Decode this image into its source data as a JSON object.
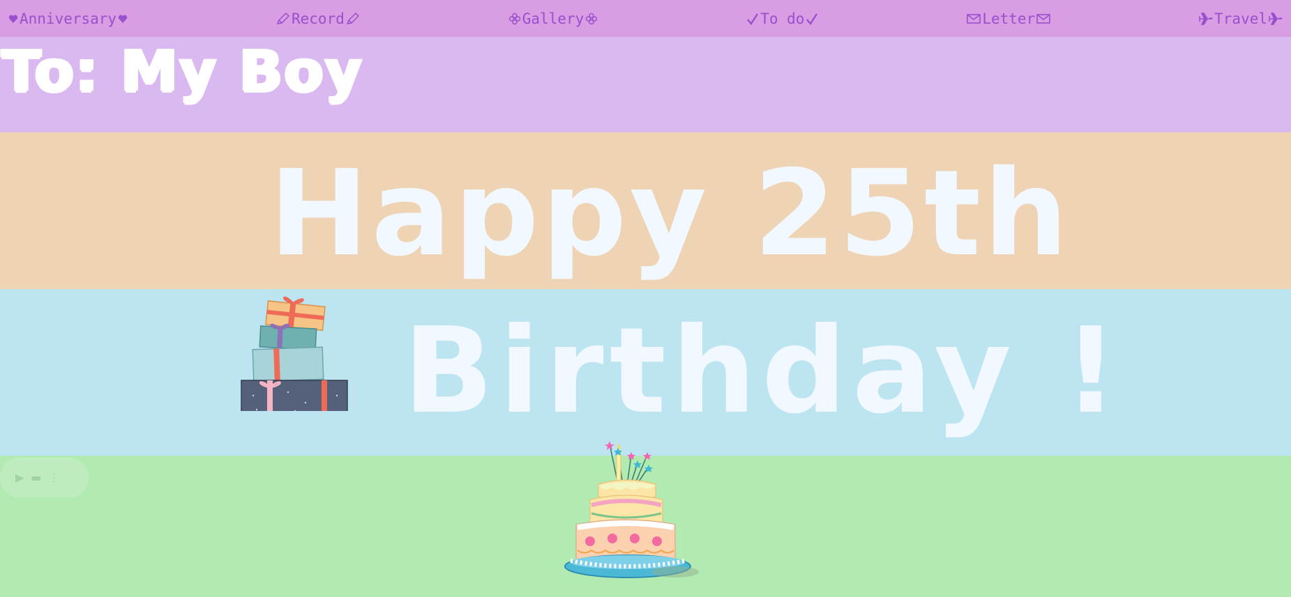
{
  "nav": {
    "anniversary": "Anniversary",
    "record": "Record",
    "gallery": "Gallery",
    "todo": "To do",
    "letter": "Letter",
    "travel": "Travel"
  },
  "heading": {
    "to": "To: My Boy"
  },
  "banner": {
    "line1": "Happy 25th",
    "line2": "Birthday !"
  },
  "icons": {
    "anniversary": "heart-icon",
    "record": "pencil-icon",
    "gallery": "flower-icon",
    "todo": "check-icon",
    "letter": "envelope-icon",
    "travel": "airplane-icon"
  },
  "colors": {
    "nav_bg": "#d99de3",
    "nav_text": "#9a4fcc",
    "band_purple": "#dab9f1",
    "band_peach": "#eed4b4",
    "band_blue": "#bde5f1",
    "band_green": "#b2ebb2",
    "text_bubble": "#f2f8ff"
  }
}
